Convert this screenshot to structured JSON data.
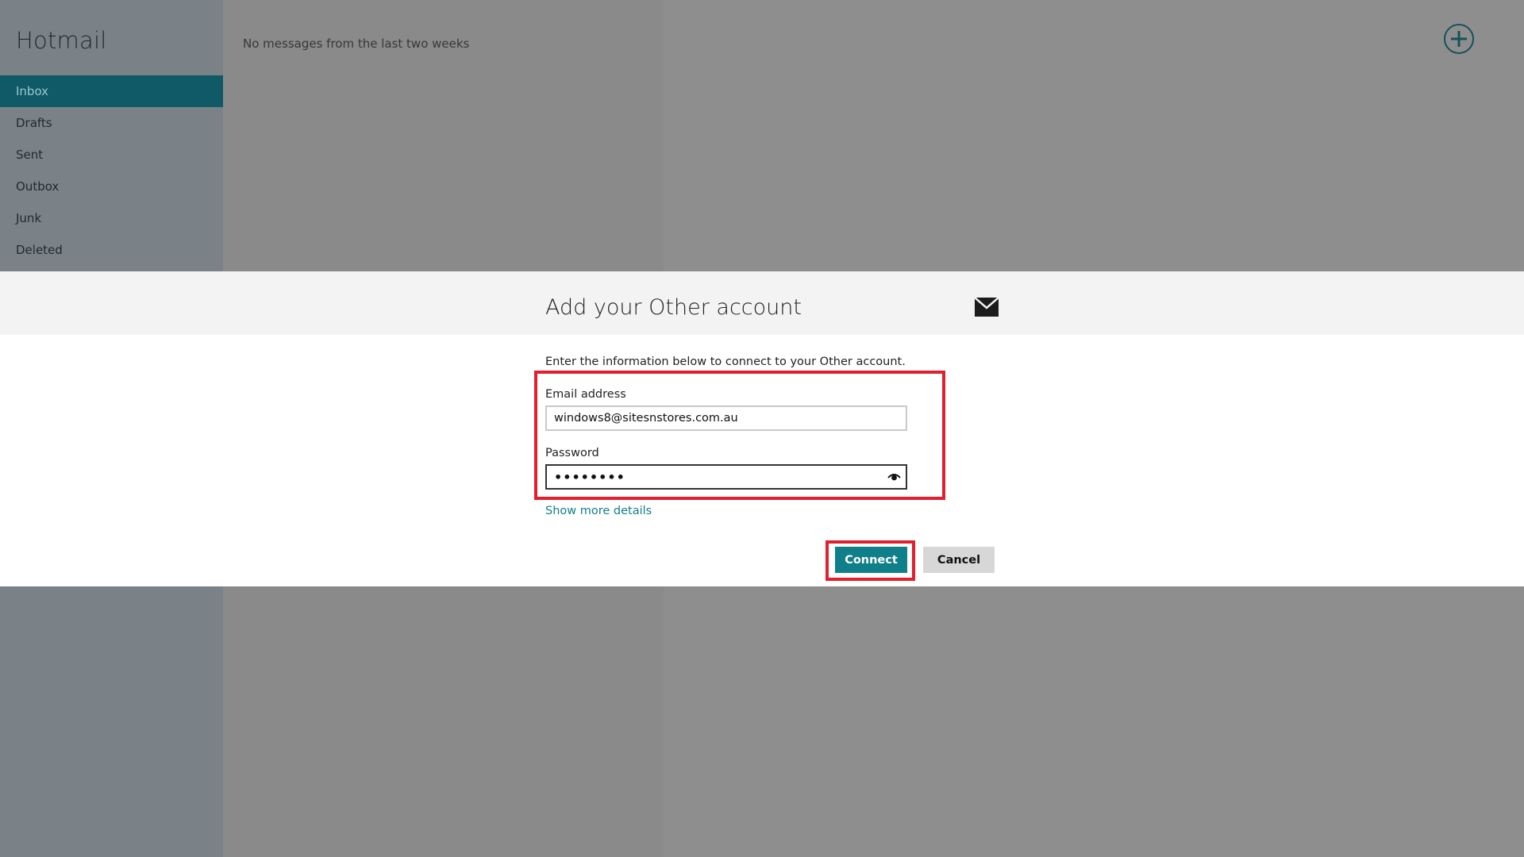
{
  "app": {
    "title": "Hotmail"
  },
  "sidebar": {
    "folders": [
      {
        "label": "Inbox",
        "active": true
      },
      {
        "label": "Drafts",
        "active": false
      },
      {
        "label": "Sent",
        "active": false
      },
      {
        "label": "Outbox",
        "active": false
      },
      {
        "label": "Junk",
        "active": false
      },
      {
        "label": "Deleted",
        "active": false
      }
    ]
  },
  "message_list": {
    "empty_text": "No messages from the last two weeks"
  },
  "reading_pane": {
    "new_button_icon": "plus-circle-icon"
  },
  "dialog": {
    "title": "Add your Other account",
    "icon": "mail-icon",
    "description": "Enter the information below to connect to your Other account.",
    "email": {
      "label": "Email address",
      "value": "windows8@sitesnstores.com.au"
    },
    "password": {
      "label": "Password",
      "masked_value": "••••••••",
      "reveal_icon": "eye-icon"
    },
    "show_more_label": "Show more details",
    "connect_label": "Connect",
    "cancel_label": "Cancel"
  },
  "colors": {
    "accent": "#0f7f8a",
    "sidebar_active": "#0f5a66",
    "highlight_box": "#e0202f",
    "overlay_sidebar": "#7b8287",
    "overlay_panes": "#8a8a8a"
  }
}
